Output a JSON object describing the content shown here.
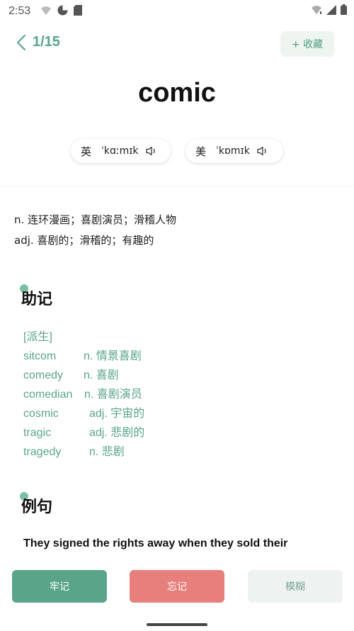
{
  "status_bar": {
    "time": "2:53"
  },
  "header": {
    "progress": "1/15",
    "favorite_label": "+ 收藏"
  },
  "word": "comic",
  "phonetics": [
    {
      "region": "英",
      "ipa": "ˈkɑːmɪk"
    },
    {
      "region": "美",
      "ipa": "ˈkɒmɪk"
    }
  ],
  "meanings": [
    "n. 连环漫画；喜剧演员；滑稽人物",
    "adj. 喜剧的；滑稽的；有趣的"
  ],
  "mnemonic": {
    "title": "助记",
    "tag": "[派生]",
    "derivatives": [
      {
        "word": "sitcom",
        "meaning": "n. 情景喜剧"
      },
      {
        "word": "comedy",
        "meaning": "n. 喜剧"
      },
      {
        "word": "comedian",
        "meaning": "n. 喜剧演员"
      },
      {
        "word": "cosmic",
        "meaning": "adj. 宇宙的"
      },
      {
        "word": "tragic",
        "meaning": "adj. 悲剧的"
      },
      {
        "word": "tragedy",
        "meaning": "n. 悲剧"
      }
    ]
  },
  "example": {
    "title": "例句",
    "sentence": "They signed the rights away when they sold their"
  },
  "actions": {
    "remember": "牢记",
    "forget": "忘记",
    "vague": "模糊"
  }
}
